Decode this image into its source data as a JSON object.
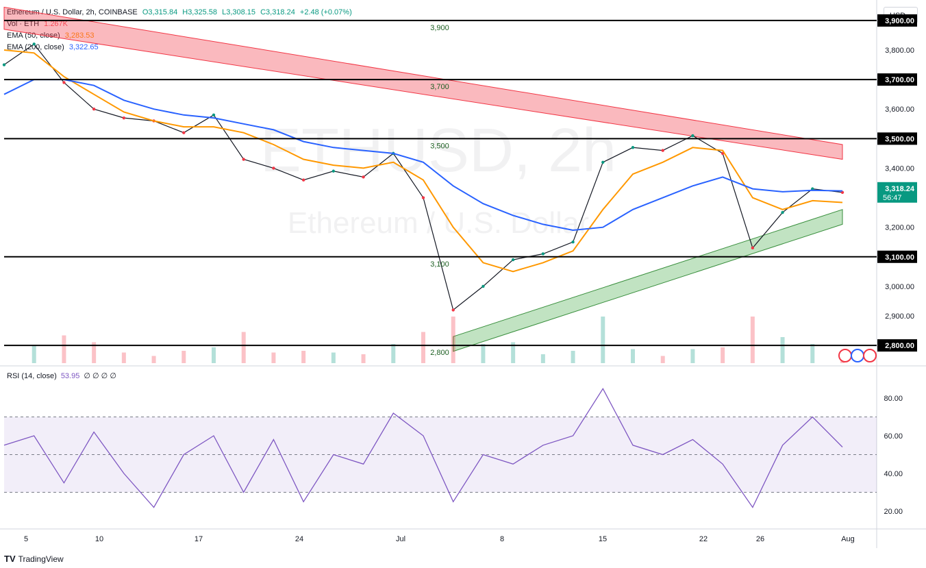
{
  "legend": {
    "symbol": "Ethereum / U.S. Dollar, 2h, COINBASE",
    "open": "O3,315.84",
    "high": "H3,325.58",
    "low": "L3,308.15",
    "close": "C3,318.24",
    "change": "+2.48 (+0.07%)",
    "vol_label": "Vol · ETH",
    "vol_value": "1.267K",
    "ema50_label": "EMA (50, close)",
    "ema50_value": "3,283.53",
    "ema200_label": "EMA (200, close)",
    "ema200_value": "3,322.65"
  },
  "watermark": {
    "ticker": "ETHUSD, 2h",
    "name": "Ethereum / U.S. Dollar"
  },
  "currency_button": "USD",
  "rsi_legend": {
    "label": "RSI (14, close)",
    "value": "53.95",
    "extra": "∅ ∅ ∅ ∅"
  },
  "footer": {
    "brand": "TradingView",
    "logo": "TV"
  },
  "colors": {
    "up": "#089981",
    "down": "#f23645",
    "ema50": "#ff9800",
    "ema200": "#2962ff",
    "rsi": "#7e57c2",
    "resistance": "#f23645",
    "support": "#4caf50"
  },
  "chart_data": {
    "type": "line",
    "title": "Ethereum / U.S. Dollar, 2h, COINBASE",
    "x_tick_labels": [
      "5",
      "10",
      "17",
      "24",
      "Jul",
      "8",
      "15",
      "22",
      "26",
      "Aug"
    ],
    "x": [
      "Jun 5",
      "Jun 7",
      "Jun 9",
      "Jun 11",
      "Jun 13",
      "Jun 15",
      "Jun 17",
      "Jun 19",
      "Jun 21",
      "Jun 23",
      "Jun 25",
      "Jun 27",
      "Jun 29",
      "Jul 1",
      "Jul 3",
      "Jul 5",
      "Jul 7",
      "Jul 9",
      "Jul 11",
      "Jul 13",
      "Jul 15",
      "Jul 17",
      "Jul 19",
      "Jul 21",
      "Jul 23",
      "Jul 25",
      "Jul 27",
      "Jul 29",
      "Jul 31"
    ],
    "y_ticks": [
      2800,
      2900,
      3000,
      3100,
      3200,
      3300,
      3400,
      3500,
      3600,
      3700,
      3800,
      3900
    ],
    "ylim": [
      2740,
      3960
    ],
    "series": [
      {
        "name": "Ethereum / U.S. Dollar",
        "values": [
          3750,
          3820,
          3690,
          3600,
          3570,
          3560,
          3520,
          3580,
          3430,
          3400,
          3360,
          3390,
          3370,
          3450,
          3300,
          2920,
          3000,
          3090,
          3110,
          3150,
          3420,
          3470,
          3460,
          3510,
          3450,
          3130,
          3250,
          3330,
          3318
        ]
      },
      {
        "name": "EMA (50, close)",
        "values": [
          3800,
          3790,
          3710,
          3650,
          3590,
          3560,
          3540,
          3540,
          3520,
          3480,
          3430,
          3410,
          3400,
          3420,
          3360,
          3200,
          3080,
          3050,
          3080,
          3120,
          3260,
          3380,
          3420,
          3470,
          3460,
          3300,
          3260,
          3290,
          3284
        ]
      },
      {
        "name": "EMA (200, close)",
        "values": [
          3650,
          3700,
          3700,
          3680,
          3630,
          3600,
          3580,
          3570,
          3550,
          3530,
          3490,
          3470,
          3460,
          3450,
          3420,
          3340,
          3280,
          3240,
          3210,
          3190,
          3200,
          3260,
          3300,
          3340,
          3370,
          3330,
          3320,
          3325,
          3323
        ]
      }
    ],
    "horizontal_levels": [
      2800,
      3100,
      3500,
      3700,
      3900
    ],
    "level_labels": [
      "2,800",
      "3,100",
      "3,500",
      "3,700",
      "3,900"
    ],
    "axis_labels": [
      "3,900.00",
      "3,800.00",
      "3,700.00",
      "3,600.00",
      "3,500.00",
      "3,400.00",
      "3,300.00",
      "3,200.00",
      "3,100.00",
      "3,000.00",
      "2,900.00",
      "2,800.00"
    ],
    "last_price_label": "3,318.24",
    "countdown": "56:47",
    "resistance_channel": {
      "start": {
        "x": "Jun 5",
        "upper": 3945,
        "lower": 3870
      },
      "end": {
        "x": "Jul 31",
        "upper": 3480,
        "lower": 3430
      }
    },
    "support_channel": {
      "start": {
        "x": "Jul 5",
        "upper": 2830,
        "lower": 2780
      },
      "end": {
        "x": "Jul 31",
        "upper": 3260,
        "lower": 3210
      }
    },
    "rsi": {
      "values": [
        55,
        60,
        35,
        62,
        40,
        22,
        50,
        60,
        30,
        58,
        25,
        50,
        45,
        72,
        60,
        25,
        50,
        45,
        55,
        60,
        85,
        55,
        50,
        58,
        45,
        22,
        55,
        70,
        54
      ],
      "ylim": [
        12,
        96
      ],
      "ticks": [
        20,
        40,
        60,
        80
      ],
      "tick_labels": [
        "20.00",
        "40.00",
        "60.00",
        "80.00"
      ],
      "band": [
        30,
        70
      ],
      "midline": 50
    }
  }
}
